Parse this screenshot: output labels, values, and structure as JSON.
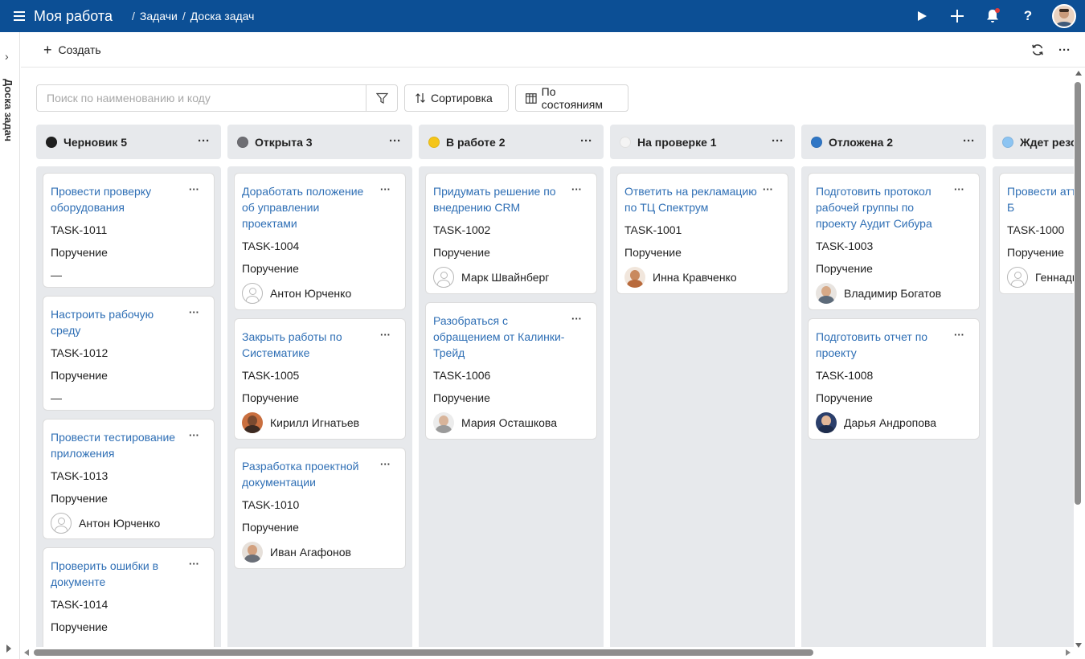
{
  "header": {
    "app_title": "Моя работа",
    "breadcrumb": [
      "Задачи",
      "Доска задач"
    ],
    "breadcrumb_separator": "/",
    "accent_color": "#0c4f95",
    "icons": [
      "menu-icon",
      "play-icon",
      "plus-icon",
      "bell-icon",
      "help-icon",
      "user-avatar"
    ]
  },
  "sidebar": {
    "label": "Доска задач"
  },
  "toolbar": {
    "create_label": "Создать",
    "refresh_icon": "refresh-icon",
    "more_icon": "more-icon"
  },
  "filters": {
    "search_placeholder": "Поиск по наименованию и коду",
    "sort_label": "Сортировка",
    "group_label": "По состояниям"
  },
  "card_type": "Поручение",
  "columns": [
    {
      "title": "Черновик 5",
      "color": "#1f1f1f",
      "cards": [
        {
          "title": "Провести проверку оборудования",
          "code": "TASK-1011",
          "type": "Поручение",
          "assignee": "—"
        },
        {
          "title": "Настроить рабочую среду",
          "code": "TASK-1012",
          "type": "Поручение",
          "assignee": "—"
        },
        {
          "title": "Провести тестирование приложения",
          "code": "TASK-1013",
          "type": "Поручение",
          "assignee": "Антон Юрченко"
        },
        {
          "title": "Проверить ошибки в документе",
          "code": "TASK-1014",
          "type": "Поручение",
          "assignee": ""
        }
      ]
    },
    {
      "title": "Открыта 3",
      "color": "#6e6e73",
      "cards": [
        {
          "title": "Доработать положение об управлении проектами",
          "code": "TASK-1004",
          "type": "Поручение",
          "assignee": "Антон Юрченко"
        },
        {
          "title": "Закрыть работы по Систематике",
          "code": "TASK-1005",
          "type": "Поручение",
          "assignee": "Кирилл Игнатьев"
        },
        {
          "title": "Разработка проектной документации",
          "code": "TASK-1010",
          "type": "Поручение",
          "assignee": "Иван Агафонов"
        }
      ]
    },
    {
      "title": "В работе 2",
      "color": "#f5c518",
      "cards": [
        {
          "title": "Придумать решение по внедрению CRM",
          "code": "TASK-1002",
          "type": "Поручение",
          "assignee": "Марк Швайнберг"
        },
        {
          "title": "Разобраться с обращением от Калинки-Трейд",
          "code": "TASK-1006",
          "type": "Поручение",
          "assignee": "Мария Осташкова"
        }
      ]
    },
    {
      "title": "На проверке 1",
      "color": "#f4f4f4",
      "cards": [
        {
          "title": "Ответить на рекламацию по ТЦ Спектрум",
          "code": "TASK-1001",
          "type": "Поручение",
          "assignee": "Инна Кравченко"
        }
      ]
    },
    {
      "title": "Отложена 2",
      "color": "#2f76c5",
      "cards": [
        {
          "title": "Подготовить протокол рабочей группы по проекту Аудит Сибура",
          "code": "TASK-1003",
          "type": "Поручение",
          "assignee": "Владимир Богатов"
        },
        {
          "title": "Подготовить отчет по проекту",
          "code": "TASK-1008",
          "type": "Поручение",
          "assignee": "Дарья Андропова"
        }
      ]
    },
    {
      "title": "Ждет резо",
      "color": "#8cc4f2",
      "cards": [
        {
          "title": "Провести атт Владимира Б",
          "code": "TASK-1000",
          "type": "Поручение",
          "assignee": "Геннади"
        }
      ]
    }
  ]
}
